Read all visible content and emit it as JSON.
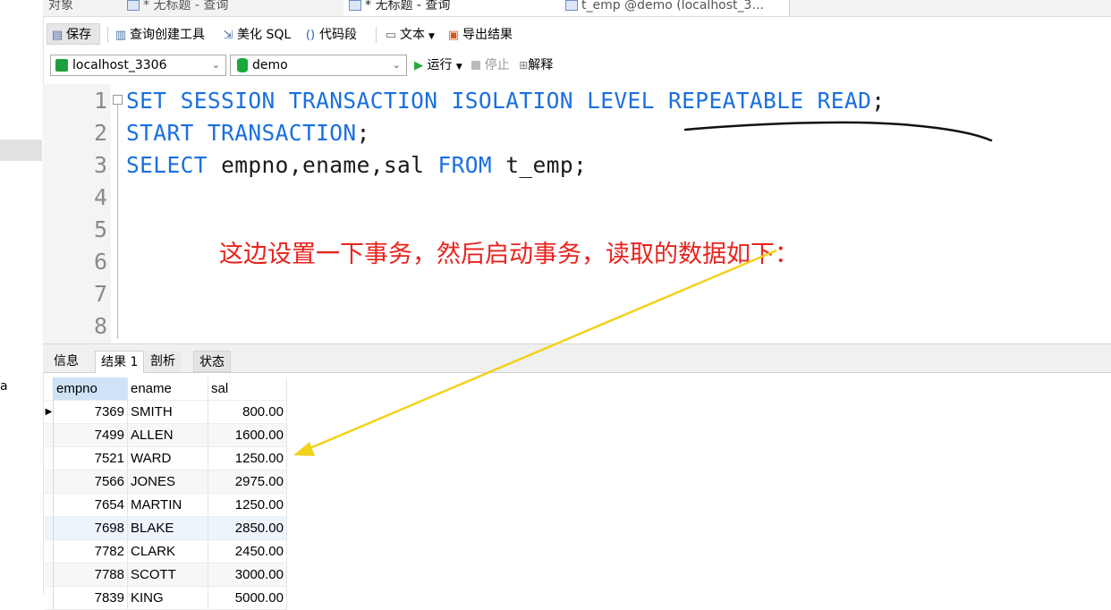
{
  "tabs": {
    "objects": "对象",
    "untitled_query_1": "* 无标题 - 查询",
    "untitled_query_2": "* 无标题 - 查询",
    "t_emp": "t_emp @demo (localhost_3..."
  },
  "toolbar": {
    "save": "保存",
    "query_builder": "查询创建工具",
    "beautify_sql": "美化 SQL",
    "code_snippet": "代码段",
    "text": "文本",
    "export_result": "导出结果"
  },
  "connection": {
    "server": "localhost_3306",
    "database": "demo",
    "run": "运行",
    "stop": "停止",
    "explain": "解释"
  },
  "editor": {
    "line_numbers": [
      "1",
      "2",
      "3",
      "4",
      "5",
      "6",
      "7",
      "8"
    ],
    "line1_kw": "SET SESSION TRANSACTION ISOLATION LEVEL REPEATABLE READ",
    "line1_end": ";",
    "line2_kw": "START TRANSACTION",
    "line2_end": ";",
    "line3_select": "SELECT",
    "line3_cols": "empno,ename,sal",
    "line3_from": "FROM",
    "line3_table": "t_emp;"
  },
  "annotation": "这边设置一下事务，然后启动事务，读取的数据如下：",
  "left_panel": {
    "fragment": "a"
  },
  "result_tabs": {
    "info": "信息",
    "result1": "结果 1",
    "profile": "剖析",
    "status": "状态"
  },
  "grid": {
    "columns": [
      "empno",
      "ename",
      "sal"
    ],
    "rows": [
      [
        "7369",
        "SMITH",
        "800.00"
      ],
      [
        "7499",
        "ALLEN",
        "1600.00"
      ],
      [
        "7521",
        "WARD",
        "1250.00"
      ],
      [
        "7566",
        "JONES",
        "2975.00"
      ],
      [
        "7654",
        "MARTIN",
        "1250.00"
      ],
      [
        "7698",
        "BLAKE",
        "2850.00"
      ],
      [
        "7782",
        "CLARK",
        "2450.00"
      ],
      [
        "7788",
        "SCOTT",
        "3000.00"
      ],
      [
        "7839",
        "KING",
        "5000.00"
      ]
    ]
  },
  "colors": {
    "keyword": "#1a6fe0",
    "annotation": "#e8231d",
    "arrow": "#f2d21b",
    "underline": "#111111"
  }
}
